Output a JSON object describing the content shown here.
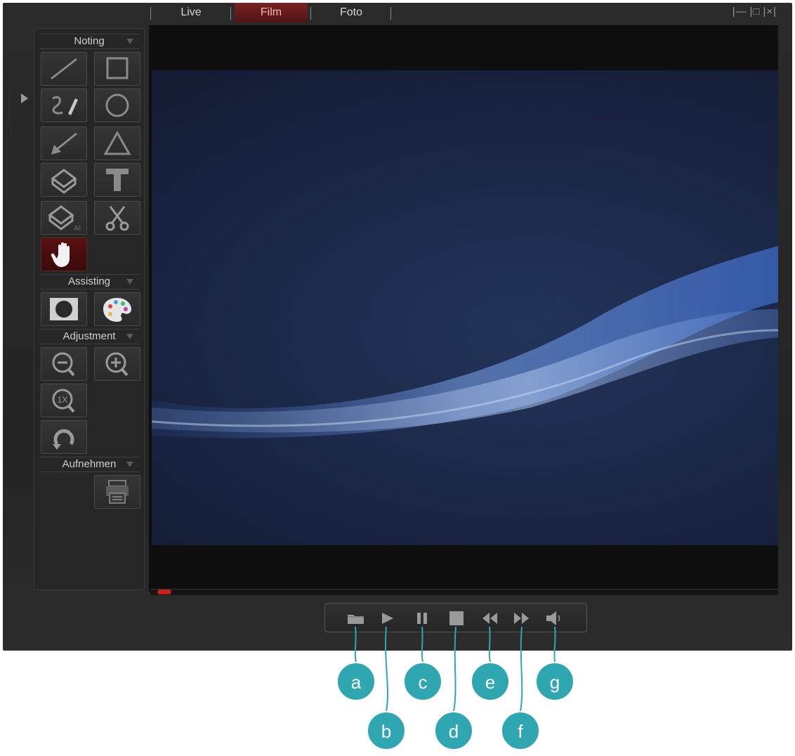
{
  "tabs": [
    {
      "label": "Live",
      "active": false
    },
    {
      "label": "Film",
      "active": true
    },
    {
      "label": "Foto",
      "active": false
    }
  ],
  "sidebar": {
    "sections": [
      {
        "title": "Noting"
      },
      {
        "title": "Assisting"
      },
      {
        "title": "Adjustment"
      },
      {
        "title": "Aufnehmen"
      }
    ],
    "eraser_all_label": "All",
    "zoom_reset_label": "1X"
  },
  "playback": {
    "progress": 0.01,
    "controls": [
      "open-folder",
      "play",
      "pause",
      "stop",
      "rewind",
      "fast-forward",
      "volume"
    ]
  },
  "callouts": [
    "a",
    "b",
    "c",
    "d",
    "e",
    "f",
    "g"
  ],
  "colors": {
    "accent": "#7a2222",
    "progress": "#c81e1e",
    "callout": "#2ea7b0"
  }
}
